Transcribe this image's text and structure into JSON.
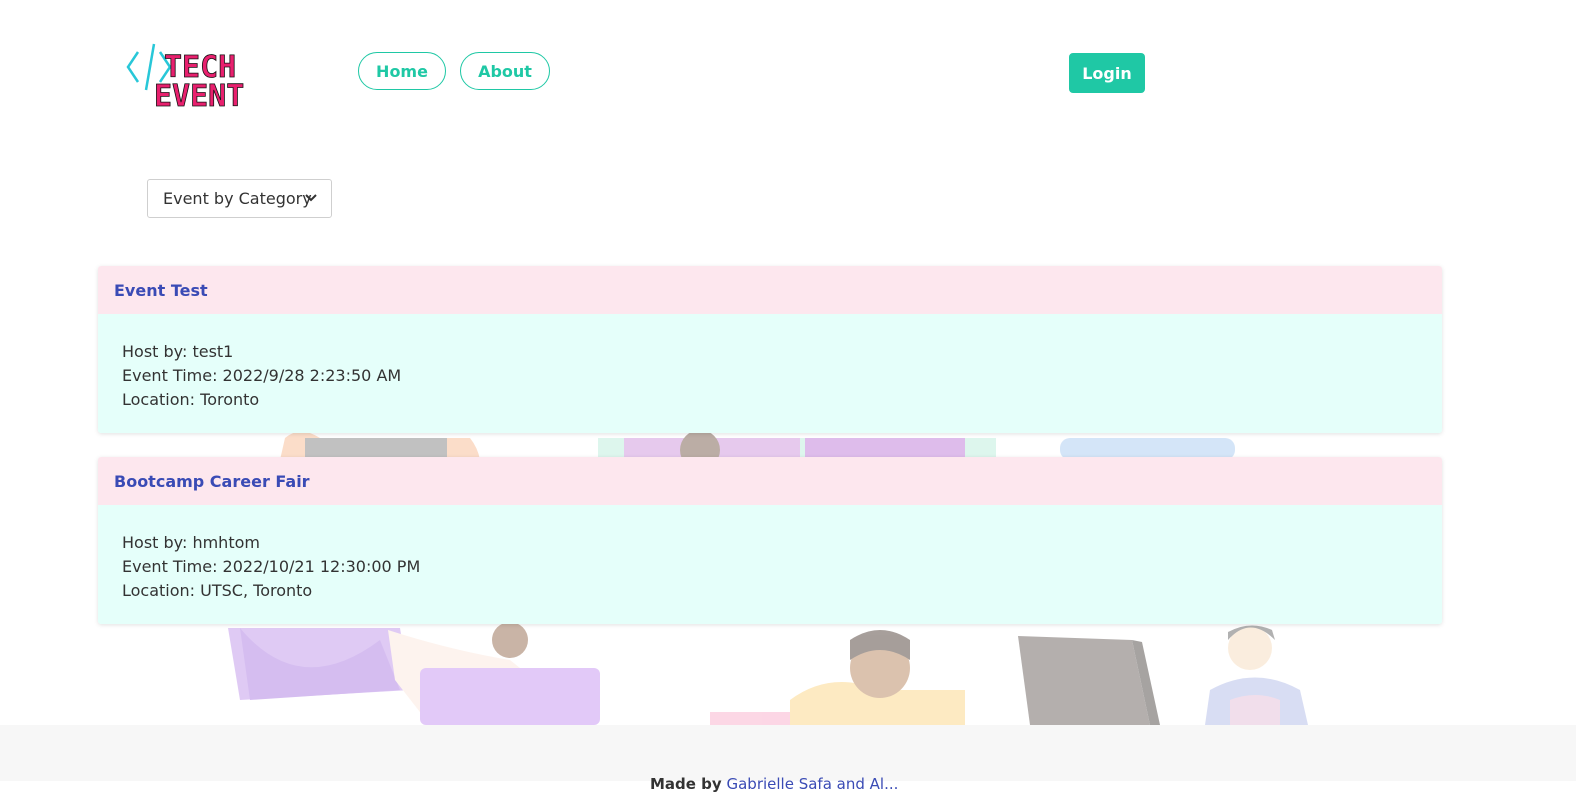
{
  "brand": {
    "logo_line1": "TECH",
    "logo_line2": "EVENT",
    "colors": {
      "accent": "#1fc8a5",
      "logo_pink": "#e8206e",
      "logo_cyan": "#28c7d8",
      "link": "#3a4bb5"
    }
  },
  "nav": {
    "home_label": "Home",
    "about_label": "About",
    "login_label": "Login"
  },
  "filter": {
    "selected": "Event by Category"
  },
  "events": [
    {
      "title": "Event Test",
      "host": "Host by: test1",
      "time": "Event Time: 2022/9/28 2:23:50 AM",
      "location": "Location: Toronto"
    },
    {
      "title": "Bootcamp Career Fair",
      "host": "Host by: hmhtom",
      "time": "Event Time: 2022/10/21 12:30:00 PM",
      "location": "Location: UTSC, Toronto"
    }
  ],
  "footer": {
    "prefix": "Made by",
    "authors": "Gabrielle Safa and Al..."
  }
}
